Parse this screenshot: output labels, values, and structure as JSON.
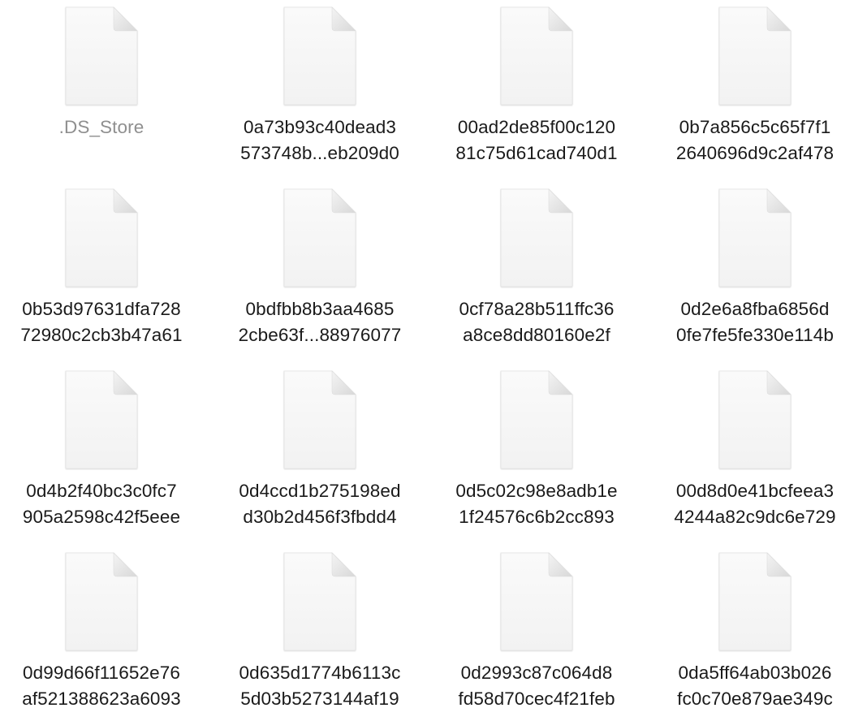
{
  "files": [
    {
      "line1": ".DS_Store",
      "line2": "",
      "hidden": true,
      "icon": "document-icon"
    },
    {
      "line1": "0a73b93c40dead3",
      "line2": "573748b...eb209d0",
      "hidden": false,
      "icon": "document-icon"
    },
    {
      "line1": "00ad2de85f00c120",
      "line2": "81c75d61cad740d1",
      "hidden": false,
      "icon": "document-icon"
    },
    {
      "line1": "0b7a856c5c65f7f1",
      "line2": "2640696d9c2af478",
      "hidden": false,
      "icon": "document-icon"
    },
    {
      "line1": "0b53d97631dfa728",
      "line2": "72980c2cb3b47a61",
      "hidden": false,
      "icon": "document-icon"
    },
    {
      "line1": "0bdfbb8b3aa4685",
      "line2": "2cbe63f...88976077",
      "hidden": false,
      "icon": "document-icon"
    },
    {
      "line1": "0cf78a28b511ffc36",
      "line2": "a8ce8dd80160e2f",
      "hidden": false,
      "icon": "document-icon"
    },
    {
      "line1": "0d2e6a8fba6856d",
      "line2": "0fe7fe5fe330e114b",
      "hidden": false,
      "icon": "document-icon"
    },
    {
      "line1": "0d4b2f40bc3c0fc7",
      "line2": "905a2598c42f5eee",
      "hidden": false,
      "icon": "document-icon"
    },
    {
      "line1": "0d4ccd1b275198ed",
      "line2": "d30b2d456f3fbdd4",
      "hidden": false,
      "icon": "document-icon"
    },
    {
      "line1": "0d5c02c98e8adb1e",
      "line2": "1f24576c6b2cc893",
      "hidden": false,
      "icon": "document-icon"
    },
    {
      "line1": "00d8d0e41bcfeea3",
      "line2": "4244a82c9dc6e729",
      "hidden": false,
      "icon": "document-icon"
    },
    {
      "line1": "0d99d66f11652e76",
      "line2": "af521388623a6093",
      "hidden": false,
      "icon": "document-icon"
    },
    {
      "line1": "0d635d1774b6113c",
      "line2": "5d03b5273144af19",
      "hidden": false,
      "icon": "document-icon"
    },
    {
      "line1": "0d2993c87c064d8",
      "line2": "fd58d70cec4f21feb",
      "hidden": false,
      "icon": "document-icon"
    },
    {
      "line1": "0da5ff64ab03b026",
      "line2": "fc0c70e879ae349c",
      "hidden": false,
      "icon": "document-icon"
    }
  ]
}
